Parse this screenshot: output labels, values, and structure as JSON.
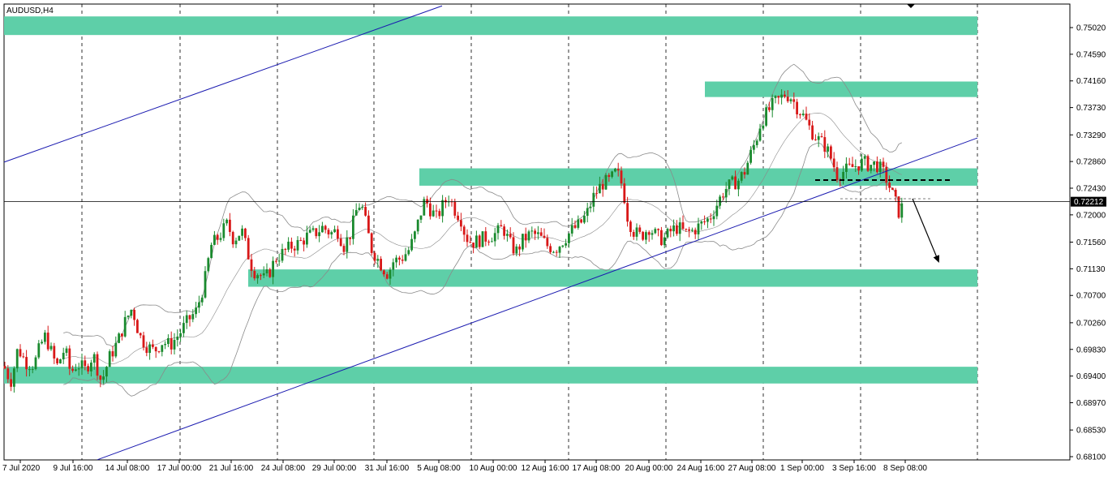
{
  "symbol_label": "AUDUSD,H4",
  "current_price_label": "0.72212",
  "colors": {
    "background": "#ffffff",
    "grid": "#000000",
    "zone": "#5ecfa8",
    "candle_up": "#1a8a2e",
    "candle_down": "#d81818",
    "channel": "#1a1ab0",
    "bollinger": "#8a8a8a",
    "text": "#000000"
  },
  "chart_data": {
    "type": "candlestick",
    "title": "AUDUSD,H4",
    "y_ticks": [
      "0.75020",
      "0.74590",
      "0.74160",
      "0.73730",
      "0.73290",
      "0.72860",
      "0.72430",
      "0.72000",
      "0.71560",
      "0.71130",
      "0.70700",
      "0.70260",
      "0.69830",
      "0.69400",
      "0.68970",
      "0.68530",
      "0.68100"
    ],
    "x_ticks": [
      "7 Jul 2020",
      "9 Jul 16:00",
      "14 Jul 08:00",
      "17 Jul 00:00",
      "21 Jul 16:00",
      "24 Jul 08:00",
      "29 Jul 00:00",
      "31 Jul 16:00",
      "5 Aug 08:00",
      "10 Aug 00:00",
      "12 Aug 16:00",
      "17 Aug 08:00",
      "20 Aug 00:00",
      "24 Aug 16:00",
      "27 Aug 08:00",
      "1 Sep 00:00",
      "3 Sep 16:00",
      "8 Sep 08:00"
    ],
    "ylim": [
      0.68,
      0.754
    ],
    "current_price": 0.72212,
    "close_path": [
      [
        0,
        0.6975
      ],
      [
        8,
        0.6945
      ],
      [
        14,
        0.6932
      ],
      [
        22,
        0.6985
      ],
      [
        32,
        0.6962
      ],
      [
        42,
        0.6958
      ],
      [
        50,
        0.699
      ],
      [
        56,
        0.7005
      ],
      [
        65,
        0.6972
      ],
      [
        70,
        0.6955
      ],
      [
        80,
        0.6985
      ],
      [
        87,
        0.6945
      ],
      [
        95,
        0.696
      ],
      [
        105,
        0.695
      ],
      [
        115,
        0.6975
      ],
      [
        125,
        0.693
      ],
      [
        135,
        0.697
      ],
      [
        145,
        0.6995
      ],
      [
        155,
        0.703
      ],
      [
        163,
        0.705
      ],
      [
        172,
        0.7005
      ],
      [
        180,
        0.699
      ],
      [
        190,
        0.698
      ],
      [
        200,
        0.6995
      ],
      [
        210,
        0.699
      ],
      [
        222,
        0.701
      ],
      [
        232,
        0.703
      ],
      [
        242,
        0.7045
      ],
      [
        252,
        0.709
      ],
      [
        260,
        0.715
      ],
      [
        270,
        0.7165
      ],
      [
        280,
        0.7185
      ],
      [
        288,
        0.716
      ],
      [
        298,
        0.7175
      ],
      [
        305,
        0.714
      ],
      [
        312,
        0.711
      ],
      [
        320,
        0.7105
      ],
      [
        326,
        0.7095
      ],
      [
        333,
        0.711
      ],
      [
        340,
        0.713
      ],
      [
        350,
        0.714
      ],
      [
        360,
        0.715
      ],
      [
        370,
        0.7155
      ],
      [
        378,
        0.7165
      ],
      [
        388,
        0.717
      ],
      [
        398,
        0.718
      ],
      [
        408,
        0.717
      ],
      [
        416,
        0.7175
      ],
      [
        424,
        0.715
      ],
      [
        432,
        0.717
      ],
      [
        440,
        0.721
      ],
      [
        445,
        0.722
      ],
      [
        452,
        0.718
      ],
      [
        458,
        0.7145
      ],
      [
        465,
        0.713
      ],
      [
        472,
        0.7115
      ],
      [
        478,
        0.7105
      ],
      [
        485,
        0.7125
      ],
      [
        495,
        0.713
      ],
      [
        505,
        0.7145
      ],
      [
        512,
        0.717
      ],
      [
        518,
        0.72
      ],
      [
        524,
        0.7225
      ],
      [
        530,
        0.721
      ],
      [
        538,
        0.7195
      ],
      [
        546,
        0.7215
      ],
      [
        553,
        0.723
      ],
      [
        560,
        0.721
      ],
      [
        568,
        0.7195
      ],
      [
        574,
        0.7165
      ],
      [
        582,
        0.7155
      ],
      [
        592,
        0.716
      ],
      [
        602,
        0.7165
      ],
      [
        612,
        0.717
      ],
      [
        620,
        0.718
      ],
      [
        628,
        0.7155
      ],
      [
        636,
        0.714
      ],
      [
        645,
        0.716
      ],
      [
        655,
        0.717
      ],
      [
        665,
        0.7165
      ],
      [
        675,
        0.715
      ],
      [
        685,
        0.7145
      ],
      [
        695,
        0.716
      ],
      [
        705,
        0.7175
      ],
      [
        715,
        0.7185
      ],
      [
        723,
        0.72
      ],
      [
        732,
        0.723
      ],
      [
        742,
        0.725
      ],
      [
        752,
        0.7255
      ],
      [
        760,
        0.727
      ],
      [
        768,
        0.7245
      ],
      [
        773,
        0.72
      ],
      [
        780,
        0.7175
      ],
      [
        790,
        0.7165
      ],
      [
        800,
        0.718
      ],
      [
        810,
        0.7165
      ],
      [
        818,
        0.716
      ],
      [
        828,
        0.7175
      ],
      [
        836,
        0.718
      ],
      [
        845,
        0.717
      ],
      [
        855,
        0.7175
      ],
      [
        865,
        0.7185
      ],
      [
        875,
        0.7195
      ],
      [
        885,
        0.722
      ],
      [
        893,
        0.724
      ],
      [
        902,
        0.725
      ],
      [
        910,
        0.7255
      ],
      [
        918,
        0.727
      ],
      [
        926,
        0.73
      ],
      [
        932,
        0.732
      ],
      [
        938,
        0.735
      ],
      [
        946,
        0.7365
      ],
      [
        954,
        0.738
      ],
      [
        960,
        0.7385
      ],
      [
        968,
        0.7395
      ],
      [
        975,
        0.739
      ],
      [
        982,
        0.7375
      ],
      [
        990,
        0.736
      ],
      [
        996,
        0.7345
      ],
      [
        1003,
        0.733
      ],
      [
        1010,
        0.732
      ],
      [
        1018,
        0.731
      ],
      [
        1025,
        0.729
      ],
      [
        1032,
        0.7265
      ],
      [
        1040,
        0.727
      ],
      [
        1048,
        0.7275
      ],
      [
        1056,
        0.728
      ],
      [
        1064,
        0.7285
      ],
      [
        1072,
        0.728
      ],
      [
        1080,
        0.7282
      ],
      [
        1088,
        0.727
      ],
      [
        1094,
        0.7255
      ],
      [
        1098,
        0.724
      ],
      [
        1104,
        0.722
      ],
      [
        1108,
        0.7205
      ],
      [
        1114,
        0.7216
      ]
    ],
    "zones": [
      {
        "top": 0.752,
        "bottom": 0.749,
        "x_from": 5
      },
      {
        "top": 0.7415,
        "bottom": 0.739,
        "x_from": 869
      },
      {
        "top": 0.7275,
        "bottom": 0.7247,
        "x_from": 517
      },
      {
        "top": 0.7112,
        "bottom": 0.7084,
        "x_from": 306
      },
      {
        "top": 0.6955,
        "bottom": 0.6928,
        "x_from": 5
      }
    ],
    "channel_lines": [
      {
        "p1": [
          5,
          0.7285
        ],
        "p2": [
          545,
          0.7537
        ]
      },
      {
        "p1": [
          120,
          0.6805
        ],
        "p2": [
          1205,
          0.7324
        ]
      }
    ],
    "support_line": {
      "x1": 1005,
      "x2": 1172,
      "y": 0.7256
    },
    "small_level": {
      "x1": 1036,
      "x2": 1150,
      "y": 0.7226
    },
    "arrow": {
      "from": [
        1125,
        0.7226
      ],
      "to": [
        1157,
        0.7125
      ]
    }
  }
}
